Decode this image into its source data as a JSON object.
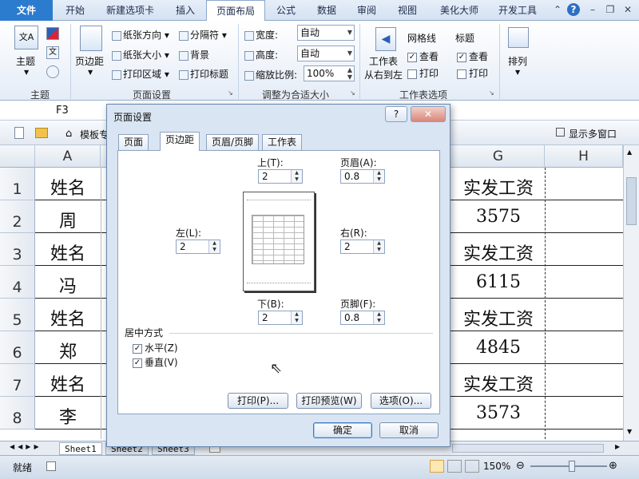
{
  "ribbon_tabs": [
    "文件",
    "开始",
    "新建选项卡",
    "插入",
    "页面布局",
    "公式",
    "数据",
    "审阅",
    "视图",
    "美化大师",
    "开发工具"
  ],
  "ribbon": {
    "theme_label": "主题",
    "margins_label": "页边距",
    "orientation_label": "纸张方向",
    "size_label": "纸张大小",
    "print_area_label": "打印区域",
    "breaks_label": "分隔符",
    "background_label": "背景",
    "print_titles_label": "打印标题",
    "width_label": "宽度:",
    "width_value": "自动",
    "height_label": "高度:",
    "height_value": "自动",
    "scale_label": "缩放比例:",
    "scale_value": "100%",
    "sheet_rtl_label1": "工作表",
    "sheet_rtl_label2": "从右到左",
    "gridlines_label": "网格线",
    "headings_label": "标题",
    "view_label": "查看",
    "print_label": "打印",
    "arrange_label": "排列",
    "group_theme": "主题",
    "group_page_setup": "页面设置",
    "group_scale": "调整为合适大小",
    "group_sheet_options": "工作表选项"
  },
  "namebox": "F3",
  "toolbar": {
    "template_label": "模板专",
    "multi_window_label": "显示多窗口"
  },
  "grid": {
    "col_a": "A",
    "col_g": "G",
    "col_h": "H",
    "rows": [
      "1",
      "2",
      "3",
      "4",
      "5",
      "6",
      "7",
      "8"
    ],
    "col_a_values": [
      "姓名",
      "周",
      "姓名",
      "冯",
      "姓名",
      "郑",
      "姓名",
      "李"
    ],
    "col_g_values": [
      "实发工资",
      "3575",
      "实发工资",
      "6115",
      "实发工资",
      "4845",
      "实发工资",
      "3573"
    ]
  },
  "sheet_tabs": [
    "Sheet1",
    "Sheet2",
    "Sheet3"
  ],
  "status": {
    "ready": "就绪",
    "zoom": "150%"
  },
  "dialog": {
    "title": "页面设置",
    "help": "?",
    "close": "✕",
    "tabs": [
      "页面",
      "页边距",
      "页眉/页脚",
      "工作表"
    ],
    "top_label": "上(T):",
    "top_value": "2",
    "header_label": "页眉(A):",
    "header_value": "0.8",
    "left_label": "左(L):",
    "left_value": "2",
    "right_label": "右(R):",
    "right_value": "2",
    "bottom_label": "下(B):",
    "bottom_value": "2",
    "footer_label": "页脚(F):",
    "footer_value": "0.8",
    "center_title": "居中方式",
    "horizontal_label": "水平(Z)",
    "vertical_label": "垂直(V)",
    "print_btn": "打印(P)...",
    "preview_btn": "打印预览(W)",
    "options_btn": "选项(O)...",
    "ok_btn": "确定",
    "cancel_btn": "取消"
  }
}
